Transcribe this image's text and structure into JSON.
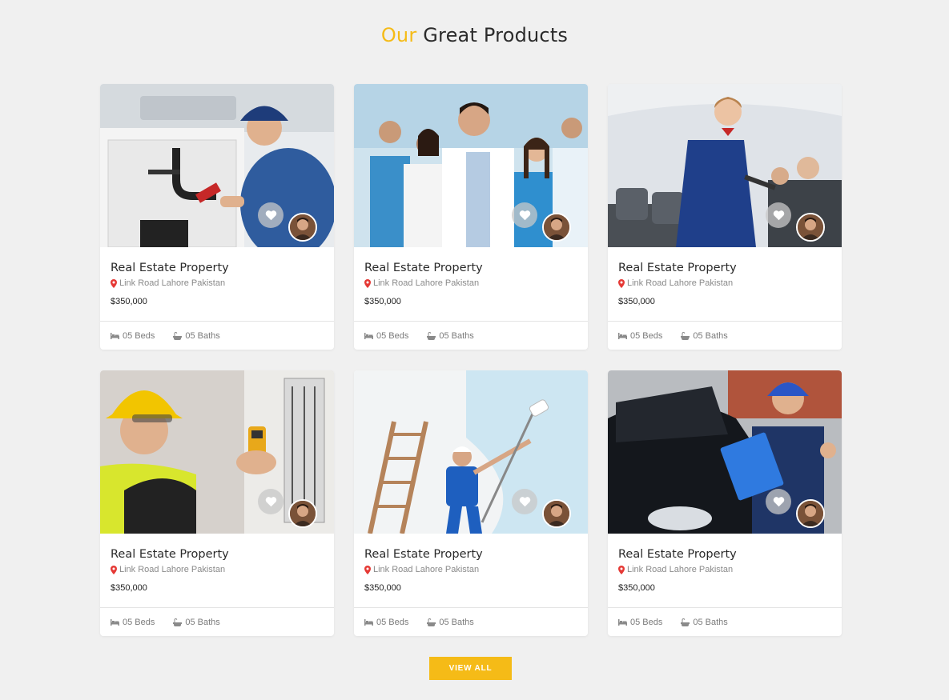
{
  "section": {
    "title_accent": "Our",
    "title_rest": " Great Products"
  },
  "colors": {
    "accent": "#f5bb17",
    "pin": "#e53935"
  },
  "cards": [
    {
      "title": "Real Estate Property",
      "location": "Link Road Lahore Pakistan",
      "price": "$350,000",
      "beds": "05 Beds",
      "baths": "05 Baths",
      "image_icon": "plumber-photo"
    },
    {
      "title": "Real Estate Property",
      "location": "Link Road Lahore Pakistan",
      "price": "$350,000",
      "beds": "05 Beds",
      "baths": "05 Baths",
      "image_icon": "medical-staff-photo"
    },
    {
      "title": "Real Estate Property",
      "location": "Link Road Lahore Pakistan",
      "price": "$350,000",
      "beds": "05 Beds",
      "baths": "05 Baths",
      "image_icon": "flight-attendant-photo"
    },
    {
      "title": "Real Estate Property",
      "location": "Link Road Lahore Pakistan",
      "price": "$350,000",
      "beds": "05 Beds",
      "baths": "05 Baths",
      "image_icon": "electrician-photo"
    },
    {
      "title": "Real Estate Property",
      "location": "Link Road Lahore Pakistan",
      "price": "$350,000",
      "beds": "05 Beds",
      "baths": "05 Baths",
      "image_icon": "painter-photo"
    },
    {
      "title": "Real Estate Property",
      "location": "Link Road Lahore Pakistan",
      "price": "$350,000",
      "beds": "05 Beds",
      "baths": "05 Baths",
      "image_icon": "mechanic-photo"
    }
  ],
  "view_all_label": "VIEW ALL"
}
